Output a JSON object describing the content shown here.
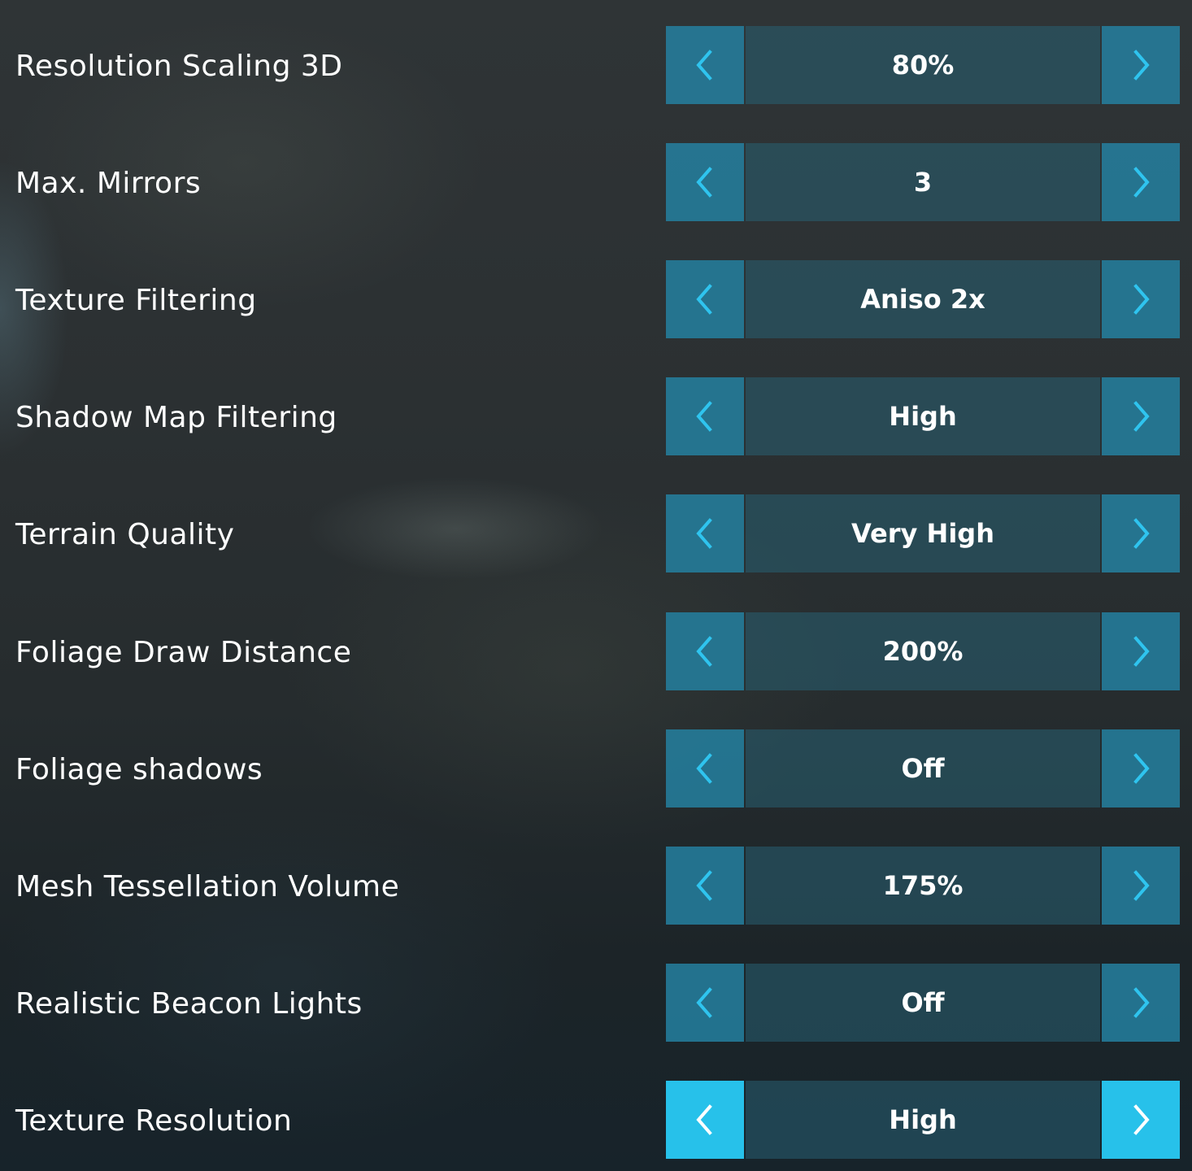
{
  "settings": [
    {
      "label": "Resolution Scaling 3D",
      "value": "80%"
    },
    {
      "label": "Max. Mirrors",
      "value": "3"
    },
    {
      "label": "Texture Filtering",
      "value": "Aniso 2x"
    },
    {
      "label": "Shadow Map Filtering",
      "value": "High"
    },
    {
      "label": "Terrain Quality",
      "value": "Very High"
    },
    {
      "label": "Foliage Draw Distance",
      "value": "200%"
    },
    {
      "label": "Foliage shadows",
      "value": "Off"
    },
    {
      "label": "Mesh Tessellation Volume",
      "value": "175%"
    },
    {
      "label": "Realistic Beacon Lights",
      "value": "Off"
    },
    {
      "label": "Texture Resolution",
      "value": "High",
      "active": true
    }
  ],
  "icons": {
    "previous": "chevron-left-icon",
    "next": "chevron-right-icon"
  },
  "colors": {
    "arrow_button": "#2480a0",
    "arrow_button_active": "#27c1ea",
    "arrow_glyph": "#2fc4ef",
    "arrow_glyph_active": "#ffffff",
    "value_box": "#286073",
    "text": "#ffffff"
  }
}
